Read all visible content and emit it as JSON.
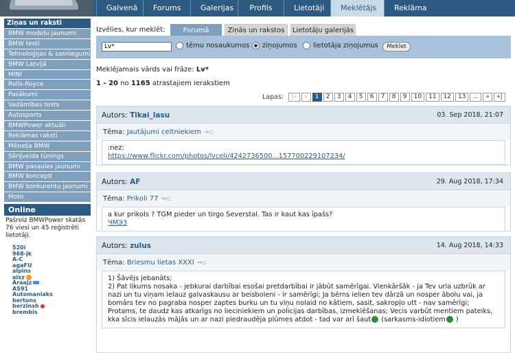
{
  "nav": {
    "items": [
      "Galvenā",
      "Forums",
      "Galerijas",
      "Profils",
      "Lietotāji",
      "Meklētājs",
      "Reklāma"
    ],
    "active": "Meklētājs"
  },
  "sidebar": {
    "section_title": "Ziņas un raksti",
    "items": [
      "BMW modeļu jaunumi",
      "BMW testi",
      "Tehnoloģijas & sasniegumi",
      "BMW Latvijā",
      "MINI",
      "Rolls-Royce",
      "Pasākumi",
      "Vadāmības tests",
      "Autosports",
      "BMWPower aktuāli",
      "Reklāmas raksti",
      "Mēneša BMW",
      "Sērijveida tūnings",
      "BMW pasaules jaunumi",
      "BMW koncepti",
      "BMW konkurentu jaunumi",
      "Moto"
    ],
    "online": {
      "title": "Online",
      "text": "Pašreiz BMWPower skatās 76 viesi un 45 reģistrēti lietotāji.",
      "users": [
        "520i",
        "968-jk",
        "A-C",
        "agaFU",
        "alpins",
        "alxz",
        "Araajz",
        "AS91",
        "Automaniaks",
        "bertons",
        "berzinsh",
        "brembis"
      ]
    }
  },
  "search": {
    "label": "Izvēlies, kur meklēt:",
    "tabs": [
      "Forumā",
      "Ziņās un rakstos",
      "Lietotāju galerijās"
    ],
    "active_tab": "Forumā",
    "input_value": "Lv*",
    "options": [
      "tēmu nosaukumos",
      "ziņojumos",
      "lietotāja ziņojumus"
    ],
    "selected_option": "ziņojumos",
    "button": "Meklet"
  },
  "results": {
    "query_label": "Meklējamais vārds vai frāze:",
    "query": "Lv*",
    "range": "1 - 20",
    "of": "no",
    "total": "1165",
    "suffix": "atrastajiem ierakstiem",
    "pager_label": "Lapas:",
    "pages": [
      "|«",
      "«",
      "1",
      "2",
      "3",
      "4",
      "5",
      "6",
      "7",
      "8",
      "9",
      "10",
      "11",
      "12",
      "13",
      "...",
      "»",
      "»|"
    ],
    "current_page": "1"
  },
  "posts": [
    {
      "author_label": "Autors:",
      "author": "Tikai_lasu",
      "date": "03. Sep 2018, 21:07",
      "topic_label": "Tēma:",
      "topic": "Jautājumi celtniekiem",
      "body_text": ":nez:",
      "body_link": "https://www.flickr.com/photos/lvceli/4242736500...157700229107234/"
    },
    {
      "author_label": "Autors:",
      "author": "AF",
      "date": "29. Aug 2018, 17:34",
      "topic_label": "Tēma:",
      "topic": "Prikoli 77",
      "body_text": "a kur prikols ? TGM pieder un tirgo Severstal. Tas ir kaut kas īpašs?",
      "body_link": "ЧМЭ3"
    },
    {
      "author_label": "Autors:",
      "author": "zulus",
      "date": "14. Aug 2018, 14:33",
      "topic_label": "Tēma:",
      "topic": "Briesmu lietas XXXI",
      "body_line1": "1) Šāvējs jebanāts;",
      "body_line2": "2) Pat likums nosaka - jebkurai darbībai esošai pretdarbībai ir jābūt samērīgai. Vienkāršāk - ja Tev urla uzbrūk ar nazi un tu viņam ielauz galvaskausu ar beisboleni - ir samērīgi; Ja bērns ielien tev dārzā un nosper ābolu vai, ja bomārs tev no pagraba nosper zaptes burku un tu viņu nolaid no kātiem, sasit, sakropļo utt - nav samērīgi; Protams, te daudz kas atkarīgs no lieciniekiem un policijas darbības, izmeklēšanas; Vecis varbūt mentiem pateiks, kka sīcis ielauzās mājās un ar nazi piedraudēja plūmes atdot - tad var arī šaut",
      "body_tail": "(sarkasms-idiotiem",
      "body_end": ")"
    }
  ]
}
